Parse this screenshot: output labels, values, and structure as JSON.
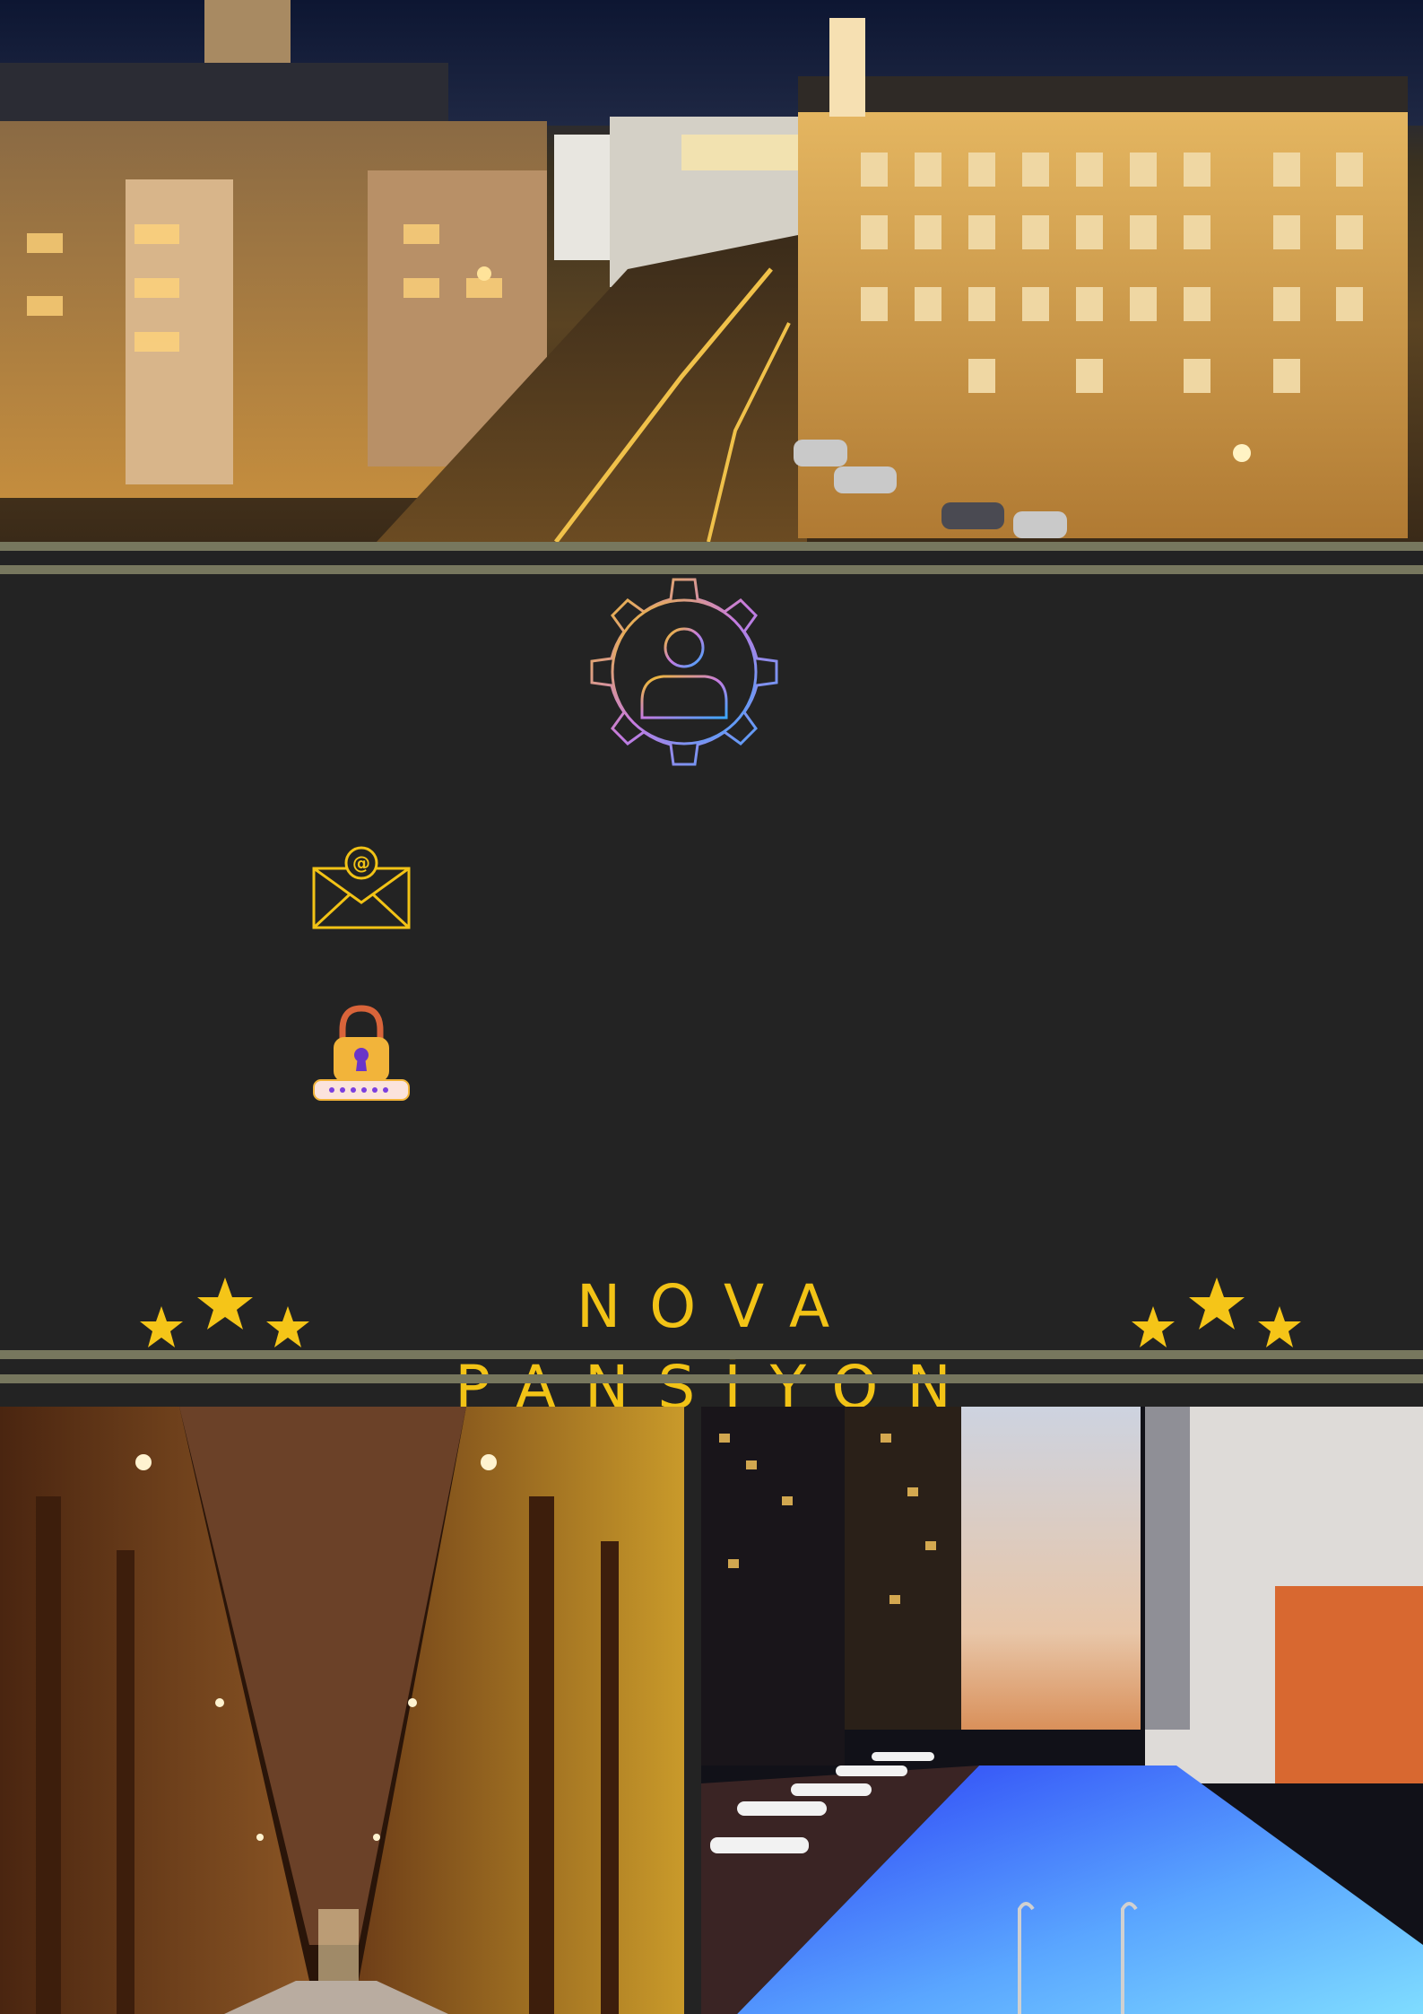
{
  "brand": {
    "title": "NOVA PANSİYON",
    "accent_color": "#f2c316"
  },
  "icons": {
    "user_settings": "user-gear-icon",
    "email": "email-at-icon",
    "password": "padlock-password-icon",
    "stars": "star-icon"
  },
  "login": {
    "email_value": "",
    "email_placeholder": "",
    "password_value": "",
    "password_placeholder": ""
  },
  "colors": {
    "background": "#232323",
    "stripe": "#77775e",
    "star": "#f5c518"
  },
  "images": {
    "hero": "city-night-street-hotel",
    "left": "hotel-corridor",
    "right": "rooftop-pool-dusk"
  }
}
